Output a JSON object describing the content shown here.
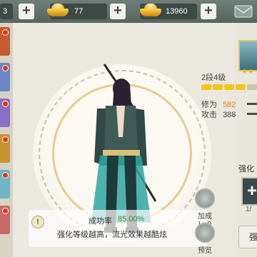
{
  "currency": {
    "first_count": "3",
    "gold": "77",
    "yuanbao": "13960"
  },
  "hero": {
    "success_rate_label": "成功率",
    "success_rate_value": "85.00%",
    "enhance_desc": "强化等级越高，流光效果越酷炫",
    "hint_icon": "!"
  },
  "actions": {
    "add": {
      "label": "加成",
      "level": "Lv.0"
    },
    "preview": {
      "label": "预览"
    }
  },
  "panel": {
    "stage": "2段4级",
    "stars": "★★",
    "progress_filled_segments": 4,
    "progress_total_segments": 5,
    "cultivation_label": "修为",
    "cultivation_value": "582",
    "attack_label": "攻击",
    "attack_value": "388",
    "section_label": "强化",
    "material_count": "1/",
    "enhance_button": "强"
  },
  "colors": {
    "accent_gold": "#f3b91a",
    "success_green": "#2e8b2e",
    "notify_red": "#e0341d"
  }
}
